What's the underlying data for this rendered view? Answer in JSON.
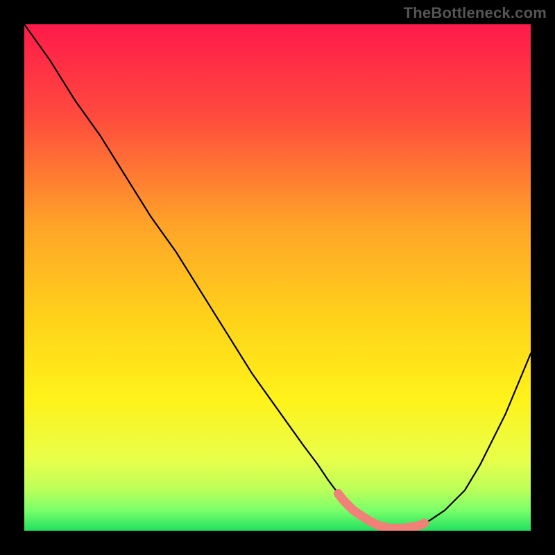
{
  "attribution": "TheBottleneck.com",
  "chart_data": {
    "type": "line",
    "title": "",
    "xlabel": "",
    "ylabel": "",
    "xlim": [
      0,
      100
    ],
    "ylim": [
      0,
      100
    ],
    "series": [
      {
        "name": "bottleneck-curve",
        "x": [
          0,
          5,
          10,
          15,
          20,
          25,
          30,
          35,
          40,
          45,
          50,
          55,
          58,
          60,
          63,
          65,
          68,
          70,
          72,
          75,
          78,
          80,
          83,
          87,
          90,
          95,
          100
        ],
        "y": [
          100,
          93,
          85,
          78,
          70,
          62,
          55,
          47,
          39,
          31,
          24,
          17,
          13,
          10,
          6,
          4,
          2,
          1,
          0.5,
          0.5,
          1,
          2,
          4,
          8,
          13,
          23,
          35
        ],
        "color": "#000000"
      }
    ],
    "highlight": {
      "name": "sweet-spot",
      "x_range": [
        62,
        79
      ],
      "color": "#f08078"
    },
    "gradient_stops": [
      {
        "offset": 0.0,
        "color": "#ff1a4a"
      },
      {
        "offset": 0.18,
        "color": "#ff4a3e"
      },
      {
        "offset": 0.4,
        "color": "#ffa528"
      },
      {
        "offset": 0.58,
        "color": "#ffd21a"
      },
      {
        "offset": 0.74,
        "color": "#fff21a"
      },
      {
        "offset": 0.86,
        "color": "#e8ff4a"
      },
      {
        "offset": 0.92,
        "color": "#baff5a"
      },
      {
        "offset": 0.96,
        "color": "#7aff6a"
      },
      {
        "offset": 1.0,
        "color": "#20e060"
      }
    ]
  }
}
